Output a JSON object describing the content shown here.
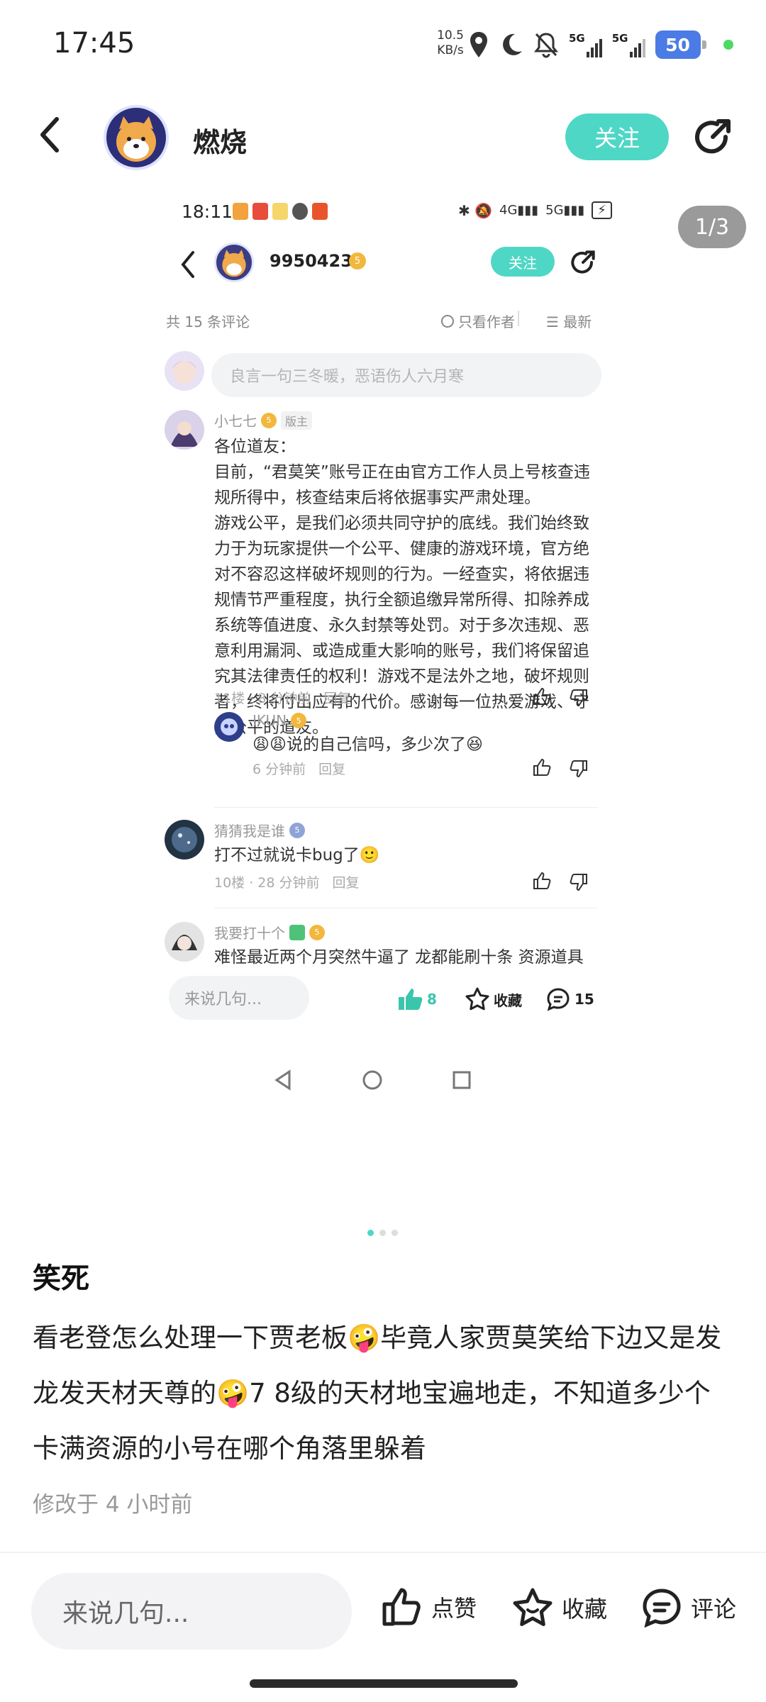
{
  "status_bar": {
    "time": "17:45",
    "net_speed_value": "10.5",
    "net_speed_unit": "KB/s",
    "signal1": "5G",
    "signal2": "5G",
    "battery": "50"
  },
  "header": {
    "username": "燃烧",
    "follow_label": "关注"
  },
  "image_pager": "1/3",
  "screenshot": {
    "time": "18:11",
    "username": "9950423",
    "level": "5",
    "follow_label": "关注",
    "comment_total": "共 15 条评论",
    "filter_author": "只看作者",
    "sort_latest": "最新",
    "input_placeholder": "良言一句三冬暖，恶语伤人六月寒",
    "comments": [
      {
        "name": "小七七",
        "level": "5",
        "tag": "版主",
        "text": "各位道友：\n目前，“君莫笑”账号正在由官方工作人员上号核查违规所得中，核查结束后将依据事实严肃处理。\n游戏公平，是我们必须共同守护的底线。我们始终致力于为玩家提供一个公平、健康的游戏环境，官方绝对不容忍这样破坏规则的行为。一经查实，将依据违规情节严重程度，执行全额追缴异常所得、扣除养成系统等值进度、永久封禁等处罚。对于多次违规、恶意利用漏洞、或造成重大影响的账号，我们将保留追究其法律责任的权利！游戏不是法外之地，破坏规则者，终将付出应有的代价。感谢每一位热爱游戏、守护公平的道友。",
        "meta": "11楼 · 8 分钟前",
        "reply": "回复"
      },
      {
        "name": "IKUN",
        "level": "5",
        "text": "😩😩说的自己信吗，多少次了😆",
        "meta": "6 分钟前",
        "reply": "回复"
      },
      {
        "name": "猜猜我是谁",
        "level": "5",
        "text": "打不过就说卡bug了🙂",
        "meta": "10楼 · 28 分钟前",
        "reply": "回复"
      },
      {
        "name": "我要打十个",
        "level": "5",
        "text": "难怪最近两个月突然牛逼了 龙都能刷十条 资源道具卖了多少rmb？ 对面一群垃圾号人人都有龙了"
      }
    ],
    "bottom_input": "来说几句...",
    "likes": "8",
    "fav_label": "收藏",
    "comments_count": "15"
  },
  "post": {
    "title": "笑死",
    "body": "看老登怎么处理一下贾老板🤪毕竟人家贾莫笑给下边又是发龙发天材天尊的🤪7 8级的天材地宝遍地走，不知道多少个卡满资源的小号在哪个角落里躲着",
    "edited": "修改于 4 小时前"
  },
  "bottom_bar": {
    "input_placeholder": "来说几句...",
    "like_label": "点赞",
    "fav_label": "收藏",
    "comment_label": "评论"
  }
}
